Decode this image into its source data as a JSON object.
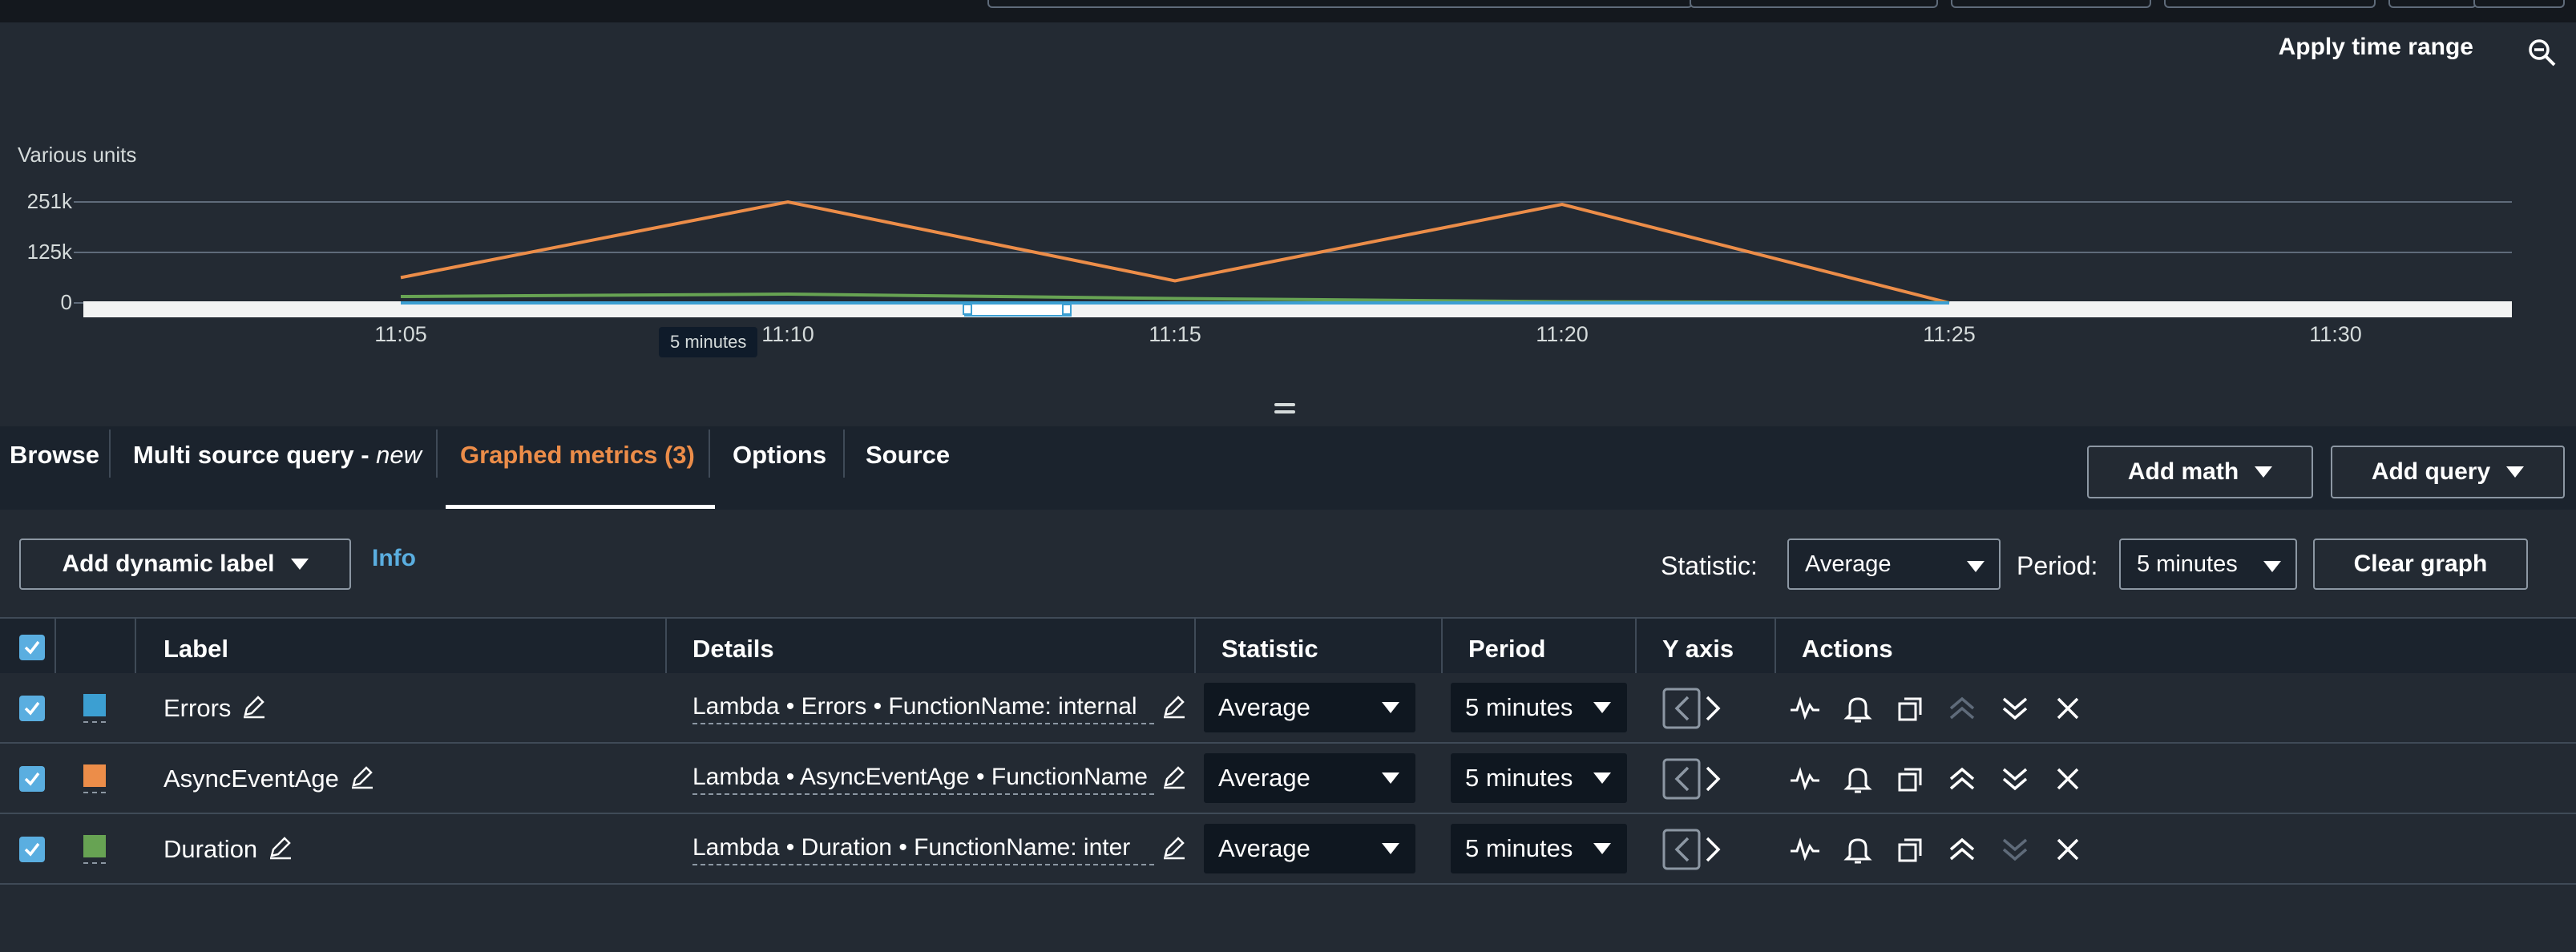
{
  "graph": {
    "apply_time_range": "Apply time range",
    "y_unit_label": "Various units",
    "y_ticks": [
      "251k",
      "125k",
      "0"
    ],
    "x_ticks": [
      "11:05",
      "11:10",
      "11:15",
      "11:20",
      "11:25",
      "11:30"
    ],
    "period_tooltip": "5 minutes",
    "icons": {
      "zoom": "zoom-out-icon"
    }
  },
  "chart_data": {
    "type": "line",
    "x": [
      "11:04",
      "11:09",
      "11:14",
      "11:19",
      "11:24"
    ],
    "series": [
      {
        "values": [
          63000,
          251000,
          55000,
          245000,
          0
        ],
        "color": "#ec8d49"
      },
      {
        "values": [
          16000,
          22000,
          11000,
          3000,
          500
        ],
        "color": "#67a353"
      },
      {
        "values": [
          0,
          0,
          0,
          0,
          0
        ],
        "color": "#3c9fd2"
      }
    ],
    "y_ticks": [
      "251k",
      "125k",
      "0"
    ],
    "ylim": [
      0,
      251000
    ],
    "ylabel": "Various units",
    "grid": true
  },
  "tabs": [
    {
      "label": "Browse"
    },
    {
      "label": "Multi source query - ",
      "suffix": "new"
    },
    {
      "label": "Graphed metrics (3)",
      "active": true
    },
    {
      "label": "Options"
    },
    {
      "label": "Source"
    }
  ],
  "header_buttons": {
    "add_math": "Add math",
    "add_query": "Add query"
  },
  "toolbar": {
    "add_dynamic_label": "Add dynamic label",
    "info": "Info",
    "statistic_label": "Statistic:",
    "statistic_value": "Average",
    "period_label": "Period:",
    "period_value": "5 minutes",
    "clear_graph": "Clear graph"
  },
  "table": {
    "columns": [
      "Label",
      "Details",
      "Statistic",
      "Period",
      "Y axis",
      "Actions"
    ],
    "rows": [
      {
        "label": "Errors",
        "details": "Lambda • Errors • FunctionName: internal",
        "statistic": "Average",
        "period": "5 minutes",
        "color": "#3c9fd2",
        "checked": true
      },
      {
        "label": "AsyncEventAge",
        "details": "Lambda • AsyncEventAge • FunctionName",
        "statistic": "Average",
        "period": "5 minutes",
        "color": "#ec8d49",
        "checked": true
      },
      {
        "label": "Duration",
        "details": "Lambda • Duration • FunctionName: inter",
        "statistic": "Average",
        "period": "5 minutes",
        "color": "#67a353",
        "checked": true
      }
    ],
    "action_icons": [
      "sparkline-icon",
      "alarm-bell-icon",
      "duplicate-icon",
      "move-up-icon",
      "move-down-icon",
      "remove-icon"
    ]
  },
  "colors": {
    "accent": "#ec8d49",
    "link": "#5aaee0",
    "checkbox": "#5aaee0"
  }
}
